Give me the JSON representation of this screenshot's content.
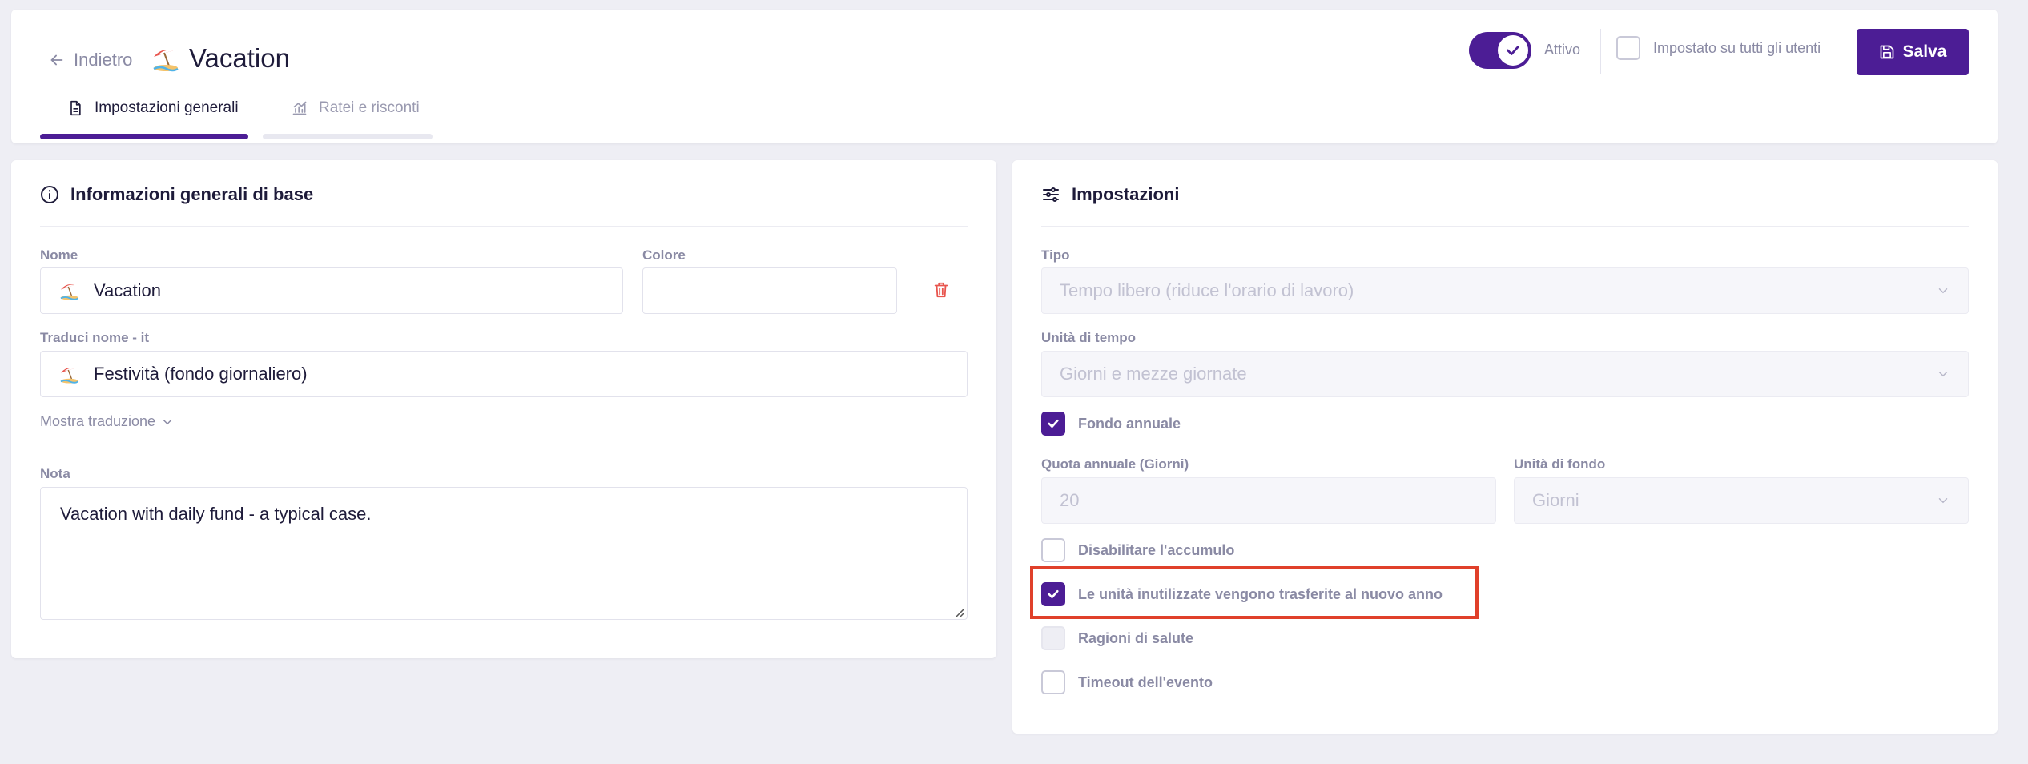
{
  "header": {
    "back_label": "Indietro",
    "title": "Vacation",
    "active_label": "Attivo",
    "all_users_label": "Impostato su tutti gli utenti",
    "save_label": "Salva",
    "tabs": [
      {
        "label": "Impostazioni generali",
        "active": true
      },
      {
        "label": "Ratei e risconti",
        "active": false
      }
    ]
  },
  "general": {
    "title": "Informazioni generali di base",
    "name_label": "Nome",
    "name_value": "Vacation",
    "color_label": "Colore",
    "color_value": "",
    "translate_label": "Traduci nome - it",
    "translate_value": "Festività (fondo giornaliero)",
    "show_translation": "Mostra traduzione",
    "note_label": "Nota",
    "note_value": "Vacation with daily fund - a typical case."
  },
  "settings": {
    "title": "Impostazioni",
    "type_label": "Tipo",
    "type_value": "Tempo libero (riduce l'orario di lavoro)",
    "time_unit_label": "Unità di tempo",
    "time_unit_value": "Giorni e mezze giornate",
    "annual_fund_label": "Fondo annuale",
    "annual_quota_label": "Quota annuale (Giorni)",
    "annual_quota_value": "20",
    "fund_unit_label": "Unità di fondo",
    "fund_unit_value": "Giorni",
    "disable_accumulation_label": "Disabilitare l'accumulo",
    "carry_over_label": "Le unità inutilizzate vengono trasferite al nuovo anno",
    "health_reasons_label": "Ragioni di salute",
    "event_timeout_label": "Timeout dell'evento"
  },
  "colors": {
    "accent": "#4c1d95",
    "danger": "#e0402a",
    "muted": "#8a8aa4",
    "background": "#eeeef4"
  },
  "icons": {
    "back": "arrow-left-icon",
    "title": "beach-umbrella-icon",
    "toggle": "check-icon",
    "save": "floppy-disk-icon",
    "tab1": "document-icon",
    "tab2": "chart-icon",
    "info": "info-circle-icon",
    "delete": "trash-icon",
    "settings": "sliders-icon"
  }
}
